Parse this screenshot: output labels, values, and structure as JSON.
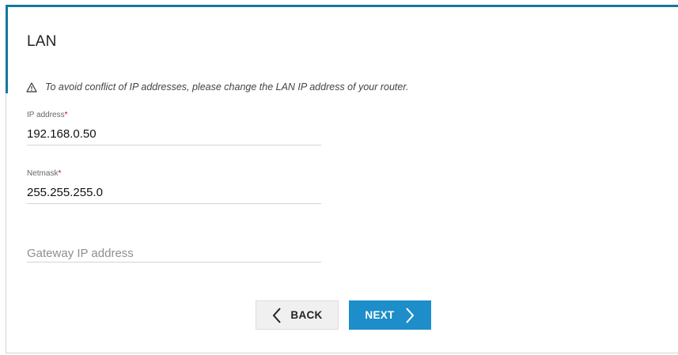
{
  "page": {
    "title": "LAN",
    "warning": "To avoid conflict of IP addresses, please change the LAN IP address of your router."
  },
  "fields": {
    "ip_address": {
      "label": "IP address",
      "required_mark": "*",
      "value": "192.168.0.50"
    },
    "netmask": {
      "label": "Netmask",
      "required_mark": "*",
      "value": "255.255.255.0"
    },
    "gateway": {
      "value": "",
      "placeholder": "Gateway IP address"
    }
  },
  "buttons": {
    "back_label": "BACK",
    "next_label": "NEXT"
  },
  "icons": {
    "warning": "warning-triangle-icon",
    "back": "chevron-left-icon",
    "next": "chevron-right-icon"
  },
  "colors": {
    "accent": "#14789d",
    "primary_button": "#1d8ec9",
    "secondary_button": "#f0f0f0",
    "required": "#d0021b"
  }
}
